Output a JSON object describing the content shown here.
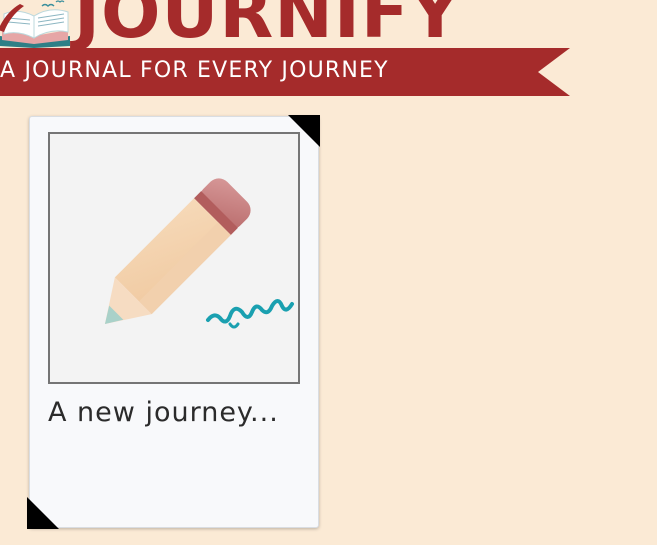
{
  "header": {
    "brand_name": "JOURNIFY",
    "tagline": "A JOURNAL FOR EVERY JOURNEY",
    "brand_color": "#a52b2b",
    "logo_icon": "open-book-icon"
  },
  "journals": [
    {
      "title": "A new journey...",
      "cover_icon": "pencil-icon"
    }
  ],
  "colors": {
    "background": "#fbead5",
    "card": "#f8f9fb",
    "ribbon": "#a52b2b",
    "ink": "#1aa0b0"
  }
}
